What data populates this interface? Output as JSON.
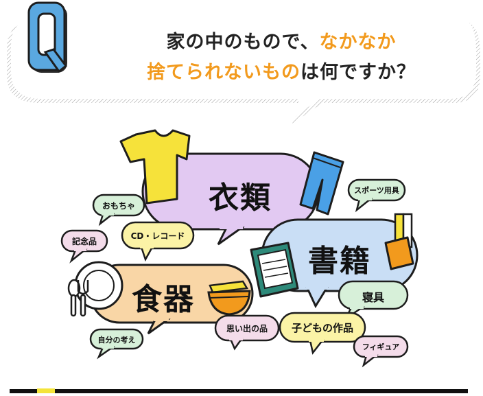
{
  "question": {
    "mark": "Q",
    "line1_black": "家の中のもので、",
    "line1_orange": "なかなか",
    "line2_orange": "捨てられないもの",
    "line2_black": "は何ですか？"
  },
  "bubbles": {
    "clothing": "衣類",
    "books": "書籍",
    "dishes": "食器",
    "omocha": "おもちゃ",
    "cd_record": "CD・レコード",
    "kinenhin": "記念品",
    "sports": "スポーツ用具",
    "bedding": "寝具",
    "memories": "思い出の品",
    "kids_work": "子どもの作品",
    "figure": "フィギュア",
    "own_thoughts": "自分の考え"
  },
  "colors": {
    "purple_bubble": "#e2c9f2",
    "blue_bubble": "#c9def5",
    "peach_bubble": "#f9d6a6",
    "green_bubble": "#d7f0d9",
    "yellow_bubble": "#fbf3a6",
    "pink_bubble": "#f4dcea",
    "q_blue": "#5aa8e0",
    "orange_text": "#f29a1d"
  }
}
